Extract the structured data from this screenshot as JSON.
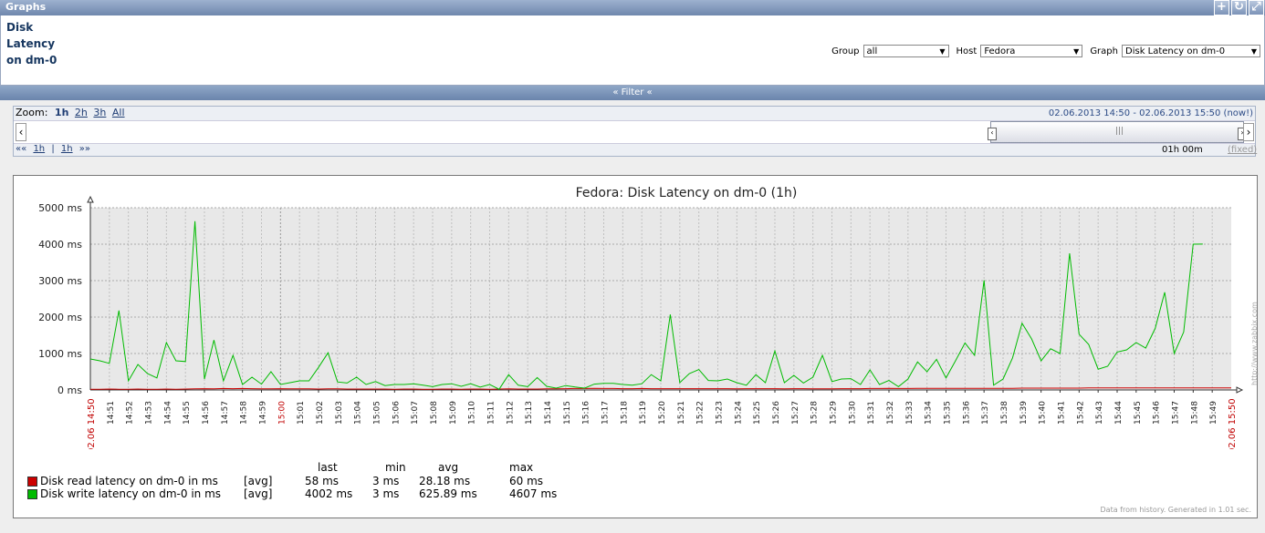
{
  "header": {
    "title": "Graphs"
  },
  "graph_name": "Disk Latency on dm-0",
  "filters": {
    "group_label": "Group",
    "group_value": "all",
    "host_label": "Host",
    "host_value": "Fedora",
    "graph_label": "Graph",
    "graph_value": "Disk Latency on dm-0"
  },
  "filter_bar": "« Filter «",
  "zoom": {
    "label": "Zoom:",
    "options": [
      "1h",
      "2h",
      "3h",
      "All"
    ],
    "active": "1h"
  },
  "period": {
    "from": "02.06.2013 14:50",
    "separator": "-",
    "to": "02.06.2013 15:50 (now!)"
  },
  "nav": {
    "back": "««",
    "back_step": "1h",
    "sep": "|",
    "fwd_step": "1h",
    "fwd": "»»"
  },
  "duration": "01h 00m",
  "fixed_label": "(fixed)",
  "chart_data": {
    "type": "line",
    "title": "Fedora: Disk Latency on dm-0 (1h)",
    "ylim": [
      0,
      5000
    ],
    "y_ticks": [
      "0 ms",
      "1000 ms",
      "2000 ms",
      "3000 ms",
      "4000 ms",
      "5000 ms"
    ],
    "x_start_label": "02.06 14:50",
    "x_end_label": "02.06 15:50",
    "x_ticks": [
      "14:51",
      "14:52",
      "14:53",
      "14:54",
      "14:55",
      "14:56",
      "14:57",
      "14:58",
      "14:59",
      "15:00",
      "15:01",
      "15:02",
      "15:03",
      "15:04",
      "15:05",
      "15:06",
      "15:07",
      "15:08",
      "15:09",
      "15:10",
      "15:11",
      "15:12",
      "15:13",
      "15:14",
      "15:15",
      "15:16",
      "15:17",
      "15:18",
      "15:19",
      "15:20",
      "15:21",
      "15:22",
      "15:23",
      "15:24",
      "15:25",
      "15:26",
      "15:27",
      "15:28",
      "15:29",
      "15:30",
      "15:31",
      "15:32",
      "15:33",
      "15:34",
      "15:35",
      "15:36",
      "15:37",
      "15:38",
      "15:39",
      "15:40",
      "15:41",
      "15:42",
      "15:43",
      "15:44",
      "15:45",
      "15:46",
      "15:47",
      "15:48",
      "15:49"
    ],
    "x_minutes": [
      0,
      0.5,
      1,
      1.5,
      2,
      2.5,
      3,
      3.5,
      4,
      4.5,
      5,
      5.5,
      6,
      6.5,
      7,
      7.5,
      8,
      8.5,
      9,
      9.5,
      10,
      10.5,
      11,
      11.5,
      12,
      12.5,
      13,
      13.5,
      14,
      14.5,
      15,
      15.5,
      16,
      16.5,
      17,
      17.5,
      18,
      18.5,
      19,
      19.5,
      20,
      20.5,
      21,
      21.5,
      22,
      22.5,
      23,
      23.5,
      24,
      24.5,
      25,
      25.5,
      26,
      26.5,
      27,
      27.5,
      28,
      28.5,
      29,
      29.5,
      30,
      30.5,
      31,
      31.5,
      32,
      32.5,
      33,
      33.5,
      34,
      34.5,
      35,
      35.5,
      36,
      36.5,
      37,
      37.5,
      38,
      38.5,
      39,
      39.5,
      40,
      40.5,
      41,
      41.5,
      42,
      42.5,
      43,
      43.5,
      44,
      44.5,
      45,
      45.5,
      46,
      46.5,
      47,
      47.5,
      48,
      48.5,
      49,
      49.5,
      50,
      50.5,
      51,
      51.5,
      52,
      52.5,
      53,
      53.5,
      54,
      54.5,
      55,
      55.5,
      56,
      56.5,
      57,
      57.5,
      58,
      58.5,
      59,
      59.5,
      60
    ],
    "series": [
      {
        "name": "Disk read latency on dm-0 in ms",
        "color": "#cc0000",
        "values": [
          20,
          20,
          25,
          20,
          20,
          25,
          20,
          20,
          25,
          20,
          25,
          30,
          35,
          30,
          40,
          35,
          40,
          35,
          30,
          30,
          35,
          30,
          30,
          30,
          25,
          30,
          30,
          25,
          25,
          25,
          25,
          25,
          20,
          25,
          25,
          20,
          20,
          25,
          25,
          20,
          25,
          25,
          20,
          25,
          30,
          25,
          25,
          25,
          30,
          30,
          35,
          40,
          40,
          45,
          40,
          40,
          35,
          35,
          40,
          35,
          35,
          35,
          35,
          35,
          35,
          35,
          35,
          35,
          30,
          35,
          35,
          35,
          35,
          30,
          35,
          35,
          30,
          30,
          30,
          35,
          35,
          35,
          40,
          40,
          45,
          40,
          40,
          45,
          45,
          45,
          45,
          45,
          45,
          45,
          45,
          45,
          45,
          45,
          50,
          50,
          50,
          50,
          50,
          50,
          50,
          55,
          55,
          55,
          55,
          55,
          55,
          55,
          55,
          55,
          55,
          55,
          55,
          55,
          58,
          58,
          58
        ]
      },
      {
        "name": "Disk write latency on dm-0 in ms",
        "color": "#00bb00",
        "values": [
          850,
          800,
          730,
          2180,
          250,
          700,
          450,
          330,
          1300,
          800,
          780,
          4630,
          300,
          1370,
          250,
          950,
          150,
          350,
          160,
          500,
          150,
          200,
          250,
          250,
          620,
          1020,
          220,
          190,
          350,
          150,
          230,
          120,
          150,
          150,
          170,
          130,
          90,
          150,
          170,
          100,
          170,
          80,
          150,
          20,
          420,
          130,
          90,
          340,
          100,
          50,
          120,
          80,
          50,
          160,
          180,
          180,
          150,
          130,
          170,
          420,
          250,
          2070,
          200,
          450,
          560,
          260,
          250,
          300,
          200,
          130,
          420,
          200,
          1070,
          200,
          400,
          190,
          350,
          950,
          230,
          300,
          310,
          150,
          550,
          150,
          260,
          90,
          300,
          770,
          500,
          840,
          330,
          800,
          1290,
          950,
          3010,
          130,
          300,
          880,
          1830,
          1400,
          800,
          1130,
          1000,
          3750,
          1530,
          1250,
          570,
          650,
          1040,
          1100,
          1300,
          1150,
          1690,
          2680,
          1000,
          1590,
          4000,
          4002
        ]
      }
    ],
    "legend": {
      "headers": [
        "last",
        "min",
        "avg",
        "max"
      ],
      "rows": [
        {
          "name": "Disk read latency on dm-0 in ms",
          "func": "[avg]",
          "last": "58 ms",
          "min": "3 ms",
          "avg": "28.18 ms",
          "max": "60 ms"
        },
        {
          "name": "Disk write latency on dm-0 in ms",
          "func": "[avg]",
          "last": "4002 ms",
          "min": "3 ms",
          "avg": "625.89 ms",
          "max": "4607 ms"
        }
      ]
    },
    "grid": true,
    "footer": "Data from history. Generated in 1.01 sec.",
    "watermark": "http://www.zabbix.com"
  }
}
